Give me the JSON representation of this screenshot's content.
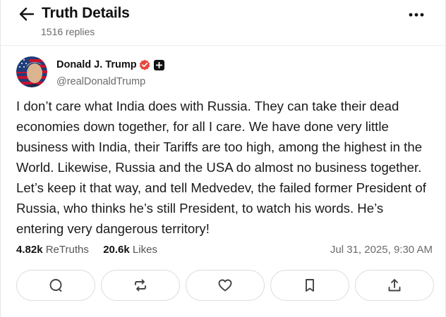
{
  "header": {
    "title": "Truth Details",
    "replies": "1516 replies"
  },
  "icons": {
    "back": "arrow-left-icon",
    "more": "more-horizontal-icon",
    "verified": "verified-badge-icon",
    "plus": "plus-badge-icon",
    "reply": "comment-icon",
    "retruth": "retruth-icon",
    "like": "heart-icon",
    "bookmark": "bookmark-icon",
    "share": "share-icon"
  },
  "author": {
    "name": "Donald J. Trump",
    "handle": "@realDonaldTrump"
  },
  "post": {
    "text": "I don’t care what India does with Russia. They can take their dead economies down together, for all I care. We have done very little business with India, their Tariffs are too high, among the highest in the World. Likewise, Russia and the USA do almost no business together. Let’s keep it that way, and tell Medvedev, the failed former President of Russia, who thinks he’s still President, to watch his words. He’s entering very dangerous territory!",
    "retruths_count": "4.82k",
    "retruths_label": "ReTruths",
    "likes_count": "20.6k",
    "likes_label": "Likes",
    "timestamp": "Jul 31, 2025, 9:30 AM"
  },
  "colors": {
    "verified": "#e8473a",
    "muted_text": "#6b6b6b",
    "border": "#dcdcdc"
  }
}
